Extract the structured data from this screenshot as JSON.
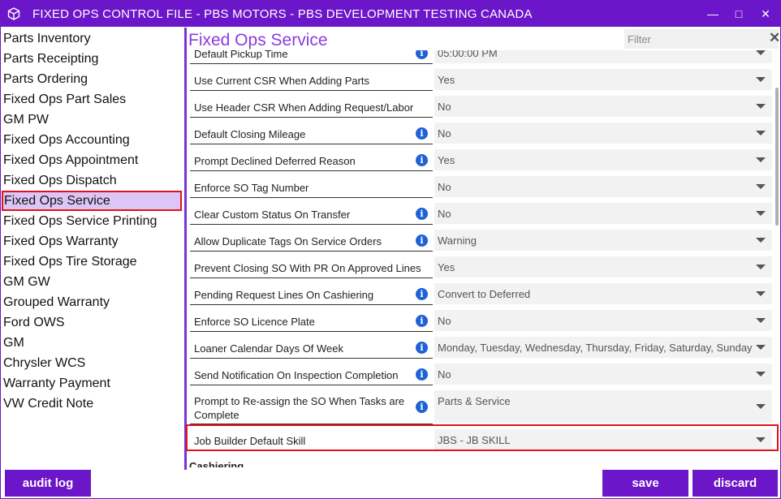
{
  "window": {
    "title": "FIXED OPS CONTROL FILE - PBS MOTORS - PBS DEVELOPMENT TESTING CANADA",
    "min_glyph": "—",
    "max_glyph": "□",
    "close_glyph": "✕"
  },
  "sidebar": {
    "items": [
      {
        "label": "Parts Inventory"
      },
      {
        "label": "Parts Receipting"
      },
      {
        "label": "Parts Ordering"
      },
      {
        "label": "Fixed Ops Part Sales"
      },
      {
        "label": "GM PW"
      },
      {
        "label": "Fixed Ops Accounting"
      },
      {
        "label": "Fixed Ops Appointment"
      },
      {
        "label": "Fixed Ops Dispatch"
      },
      {
        "label": "Fixed Ops Service",
        "active": true
      },
      {
        "label": "Fixed Ops Service Printing"
      },
      {
        "label": "Fixed Ops Warranty"
      },
      {
        "label": "Fixed Ops Tire Storage"
      },
      {
        "label": "GM GW"
      },
      {
        "label": "Grouped Warranty"
      },
      {
        "label": "Ford OWS"
      },
      {
        "label": "GM"
      },
      {
        "label": "Chrysler WCS"
      },
      {
        "label": "Warranty Payment"
      },
      {
        "label": "VW Credit Note"
      }
    ]
  },
  "main": {
    "title": "Fixed Ops Service",
    "filter": {
      "placeholder": "Filter",
      "value": "",
      "clear_glyph": "✕"
    },
    "settings": [
      {
        "label": "Default Pickup Time",
        "info": true,
        "value": "05:00:00 PM"
      },
      {
        "label": "Use Current CSR When Adding Parts",
        "info": false,
        "value": "Yes"
      },
      {
        "label": "Use Header CSR When Adding Request/Labor",
        "info": false,
        "value": "No"
      },
      {
        "label": "Default Closing Mileage",
        "info": true,
        "value": "No"
      },
      {
        "label": "Prompt Declined Deferred Reason",
        "info": true,
        "value": "Yes"
      },
      {
        "label": "Enforce SO Tag Number",
        "info": false,
        "value": "No"
      },
      {
        "label": "Clear Custom Status On Transfer",
        "info": true,
        "value": "No"
      },
      {
        "label": "Allow Duplicate Tags On Service Orders",
        "info": true,
        "value": "Warning"
      },
      {
        "label": "Prevent Closing SO With PR On Approved Lines",
        "info": false,
        "value": "Yes"
      },
      {
        "label": "Pending Request Lines On Cashiering",
        "info": true,
        "value": "Convert to Deferred"
      },
      {
        "label": "Enforce SO Licence Plate",
        "info": true,
        "value": "No"
      },
      {
        "label": "Loaner Calendar Days Of Week",
        "info": true,
        "value": "Monday, Tuesday, Wednesday, Thursday, Friday, Saturday, Sunday"
      },
      {
        "label": "Send Notification On Inspection Completion",
        "info": true,
        "value": "No"
      },
      {
        "label": "Prompt to Re-assign the SO When Tasks are Complete",
        "info": true,
        "value": "Parts & Service"
      },
      {
        "label": "Job Builder Default Skill",
        "info": false,
        "value": "JBS - JB SKILL",
        "highlighted": true
      }
    ],
    "section_heading": "Cashiering",
    "info_glyph": "i"
  },
  "footer": {
    "audit_label": "audit log",
    "save_label": "save",
    "discard_label": "discard"
  },
  "colors": {
    "accent": "#6b16c9",
    "title_text": "#8a3ce0",
    "active_bg": "#dcc6f5",
    "highlight_border": "#e0121f",
    "info_icon": "#1f62d6"
  }
}
